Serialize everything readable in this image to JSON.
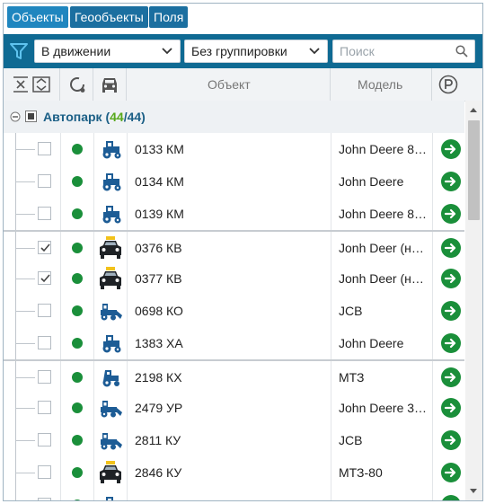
{
  "tabs": [
    {
      "label": "Объекты",
      "active": true
    },
    {
      "label": "Геообъекты",
      "active": false
    },
    {
      "label": "Поля",
      "active": false
    }
  ],
  "filter": {
    "status_value": "В движении",
    "grouping_value": "Без группировки",
    "search_placeholder": "Поиск"
  },
  "columns": {
    "object": "Объект",
    "model": "Модель"
  },
  "group": {
    "name": "Автопарк",
    "count_active": "44",
    "count_total": "44"
  },
  "colors": {
    "accent": "#0f6a93",
    "online": "#1a8f3a",
    "count_green": "#57a81b"
  },
  "rows": [
    {
      "name": "0133 КМ",
      "model": "John Deere 8…",
      "icon": "tractor-icon",
      "checked": false
    },
    {
      "name": "0134 КМ",
      "model": "John Deere",
      "icon": "tractor-icon",
      "checked": false
    },
    {
      "name": "0139 КМ",
      "model": "John Deere 8…",
      "icon": "tractor-icon",
      "checked": false
    },
    {
      "name": "0376 КВ",
      "model": "Jonh Deer (н…",
      "icon": "taxi-car-icon",
      "checked": true
    },
    {
      "name": "0377 КВ",
      "model": "Jonh Deer (н…",
      "icon": "taxi-car-icon",
      "checked": true
    },
    {
      "name": "0698 КО",
      "model": "JCB",
      "icon": "excavator-icon",
      "checked": false
    },
    {
      "name": "1383 ХА",
      "model": "John Deere",
      "icon": "tractor-icon",
      "checked": false
    },
    {
      "name": "2198 КХ",
      "model": "МТЗ",
      "icon": "small-tractor-icon",
      "checked": false
    },
    {
      "name": "2479 УР",
      "model": "John Deere 3…",
      "icon": "excavator-icon",
      "checked": false
    },
    {
      "name": "2811 КУ",
      "model": "JCB",
      "icon": "excavator-icon",
      "checked": false
    },
    {
      "name": "2846 КУ",
      "model": "МТЗ-80",
      "icon": "taxi-car-icon",
      "checked": false
    }
  ]
}
